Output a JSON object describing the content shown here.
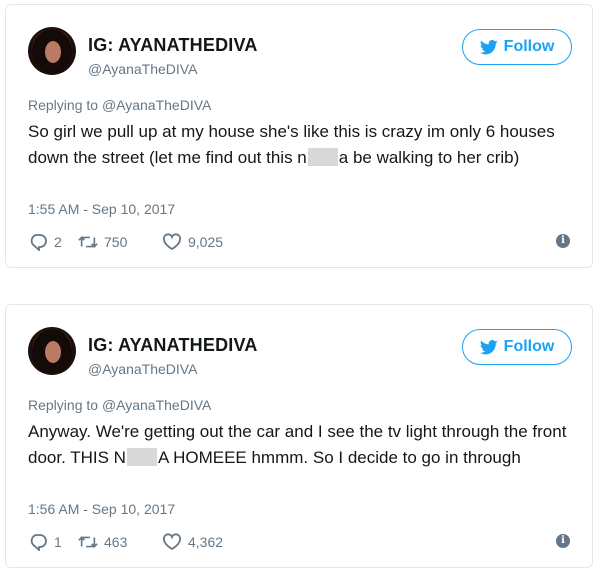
{
  "tweets": [
    {
      "display_name": "IG: AYANATHEDIVA",
      "handle": "@AyanaTheDIVA",
      "follow_label": "Follow",
      "replying_prefix": "Replying to",
      "replying_to": "@AyanaTheDIVA",
      "text_part1": "So girl we pull up at my house she's like this is crazy im only 6 houses down the street (let me find out this n",
      "text_part2": "a be walking to her crib)",
      "timestamp": "1:55 AM - Sep 10, 2017",
      "replies": "2",
      "retweets": "750",
      "likes": "9,025"
    },
    {
      "display_name": "IG: AYANATHEDIVA",
      "handle": "@AyanaTheDIVA",
      "follow_label": "Follow",
      "replying_prefix": "Replying to",
      "replying_to": "@AyanaTheDIVA",
      "text_part1": "Anyway. We're getting out the car and I see the tv light through the front door. THIS N",
      "text_part2": "A HOMEEE hmmm. So I decide to go in through",
      "timestamp": "1:56 AM - Sep 10, 2017",
      "replies": "1",
      "retweets": "463",
      "likes": "4,362"
    }
  ],
  "colors": {
    "accent": "#1da1f2",
    "muted": "#657786",
    "text": "#14171a",
    "border": "#e1e8ed"
  },
  "icons": {
    "follow": "twitter-bird-icon",
    "reply": "reply-icon",
    "retweet": "retweet-icon",
    "like": "heart-icon",
    "info": "info-icon"
  }
}
